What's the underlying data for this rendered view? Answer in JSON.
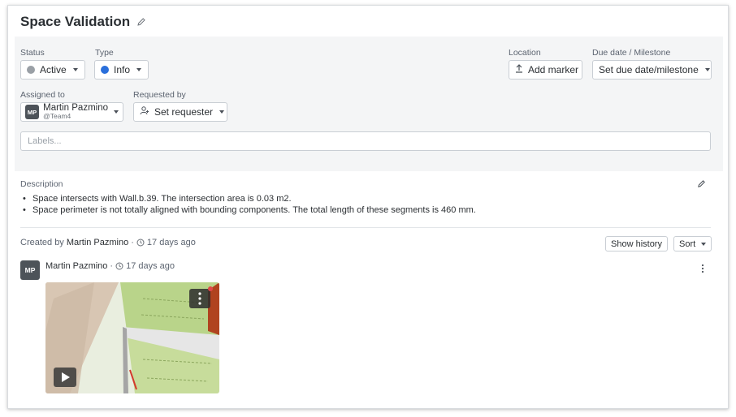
{
  "header": {
    "title": "Space Validation"
  },
  "properties": {
    "status": {
      "label": "Status",
      "value": "Active",
      "color": "#9aa0a6"
    },
    "type": {
      "label": "Type",
      "value": "Info",
      "color": "#2a6fdb"
    },
    "location": {
      "label": "Location",
      "button": "Add marker"
    },
    "due_date": {
      "label": "Due date / Milestone",
      "button": "Set due date/milestone"
    },
    "assigned_to": {
      "label": "Assigned to",
      "initials": "MP",
      "name": "Martin Pazmino",
      "team": "@Team4"
    },
    "requested_by": {
      "label": "Requested by",
      "button": "Set requester"
    },
    "labels_placeholder": "Labels..."
  },
  "description": {
    "label": "Description",
    "items": [
      "Space intersects with Wall.b.39. The intersection area is 0.03 m2.",
      "Space perimeter is not totally aligned with bounding components. The total length of these segments is 460 mm."
    ]
  },
  "activity": {
    "created_prefix": "Created by",
    "created_by": "Martin Pazmino",
    "separator": "·",
    "created_ago": "17 days ago",
    "show_history": "Show history",
    "sort": "Sort"
  },
  "comment": {
    "initials": "MP",
    "author": "Martin Pazmino",
    "separator": "·",
    "ago": "17 days ago",
    "attachment_icon": "play-icon"
  }
}
